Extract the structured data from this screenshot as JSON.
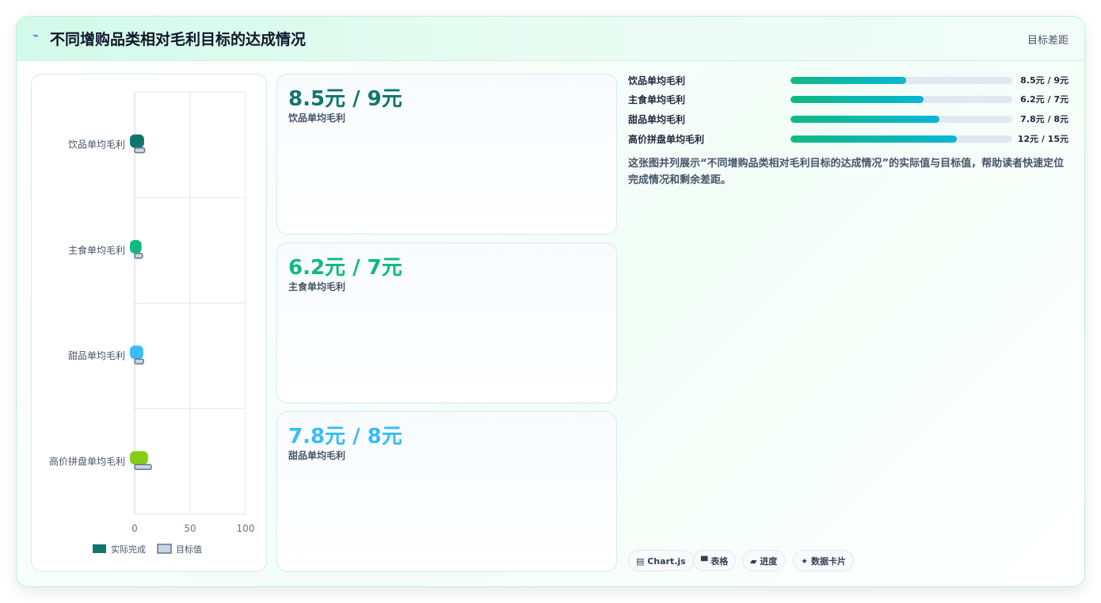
{
  "header": {
    "icon": "lightning-icon",
    "title": "不同增购品类相对毛利目标的达成情况",
    "right_label": "目标差距"
  },
  "chart_data": {
    "type": "bar",
    "orientation": "horizontal",
    "categories": [
      "饮品单均毛利",
      "主食单均毛利",
      "甜品单均毛利",
      "高价拼盘单均毛利"
    ],
    "series": [
      {
        "name": "实际完成",
        "values": [
          8.5,
          6.2,
          7.8,
          12
        ],
        "colors": [
          "#0f766e",
          "#10b981",
          "#38bdf8",
          "#84cc16"
        ]
      },
      {
        "name": "目标值",
        "values": [
          9,
          7,
          8,
          15
        ],
        "color": "#cbd5e1",
        "border": "#64748b"
      }
    ],
    "x_ticks": [
      "0",
      "50",
      "100"
    ],
    "xlim": [
      0,
      100
    ],
    "grid": true,
    "legend_position": "bottom"
  },
  "stat_cards": [
    {
      "value": "8.5元 / 9元",
      "label": "饮品单均毛利",
      "color": "#0f766e"
    },
    {
      "value": "6.2元 / 7元",
      "label": "主食单均毛利",
      "color": "#10b981"
    },
    {
      "value": "7.8元 / 8元",
      "label": "甜品单均毛利",
      "color": "#38bdf8"
    }
  ],
  "progress": [
    {
      "label": "饮品单均毛利",
      "value": "8.5元 / 9元",
      "fraction": 0.52
    },
    {
      "label": "主食单均毛利",
      "value": "6.2元 / 7元",
      "fraction": 0.6
    },
    {
      "label": "甜品单均毛利",
      "value": "7.8元 / 8元",
      "fraction": 0.67
    },
    {
      "label": "高价拼盘单均毛利",
      "value": "12元 / 15元",
      "fraction": 0.75
    }
  ],
  "description": "这张图并列展示“不同增购品类相对毛利目标的达成情况”的实际值与目标值，帮助读者快速定位完成情况和剩余差距。",
  "tags": [
    {
      "icon": "chart-icon",
      "label": "▤ Chart.js"
    },
    {
      "icon": "table-icon",
      "label": "▀ 表格"
    },
    {
      "icon": "progress-icon",
      "label": "▰ 进度"
    },
    {
      "icon": "sparkle-icon",
      "label": "✦ 数据卡片"
    }
  ]
}
